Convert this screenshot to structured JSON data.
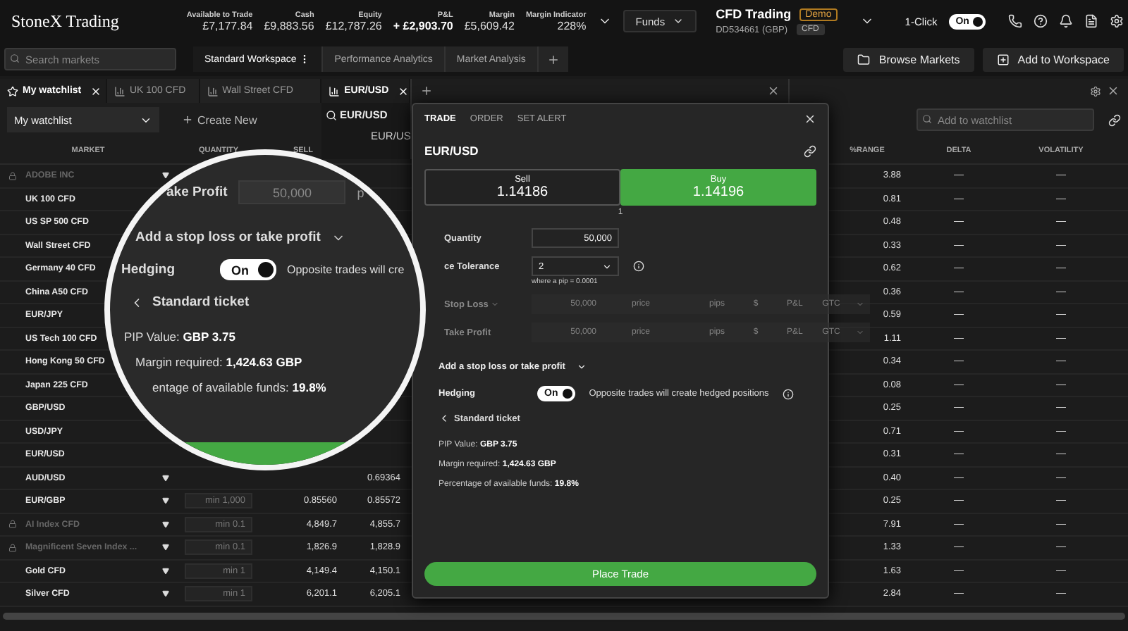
{
  "top_bar": {
    "logo": "StoneX Trading",
    "stats": [
      {
        "label": "Available to Trade",
        "value": "£7,177.84",
        "emphasis": false
      },
      {
        "label": "Cash",
        "value": "£9,883.56",
        "emphasis": false
      },
      {
        "label": "Equity",
        "value": "£12,787.26",
        "emphasis": false
      },
      {
        "label": "P&L",
        "value": "+ £2,903.70",
        "emphasis": true
      },
      {
        "label": "Margin",
        "value": "£5,609.42",
        "emphasis": false
      },
      {
        "label": "Margin Indicator",
        "value": "228%",
        "emphasis": false
      }
    ],
    "funds_button": "Funds",
    "account": {
      "name": "CFD Trading",
      "badge": "Demo",
      "id": "DD534661 (GBP)",
      "tag": "CFD"
    },
    "one_click": {
      "label": "1-Click",
      "on": true,
      "state_label": "On"
    }
  },
  "search": {
    "placeholder": "Search markets"
  },
  "workspace_tabs": [
    {
      "label": "Standard Workspace",
      "selected": true
    },
    {
      "label": "Performance Analytics",
      "selected": false
    },
    {
      "label": "Market Analysis",
      "selected": false
    }
  ],
  "actions": [
    "Browse Markets",
    "Add to Workspace"
  ],
  "panel_tabs": [
    {
      "label": "My watchlist",
      "kind": "watchlist",
      "selected": true,
      "closable": true
    },
    {
      "label": "UK 100 CFD",
      "kind": "chart",
      "selected": false,
      "closable": false
    },
    {
      "label": "Wall Street CFD",
      "kind": "chart",
      "selected": false,
      "closable": false
    },
    {
      "label": "EUR/USD",
      "kind": "chart",
      "selected": true,
      "closable": true
    }
  ],
  "watchlist": {
    "dropdown": "My watchlist",
    "create": "Create New",
    "add_placeholder": "Add to watchlist",
    "columns": [
      "MARKET",
      "QUANTITY",
      "SELL",
      "%RANGE",
      "DELTA",
      "VOLATILITY"
    ],
    "rows": [
      {
        "name": "ADOBE INC",
        "locked": true,
        "dropdown": true,
        "range": "3.88",
        "delta": "—",
        "volatility": "—"
      },
      {
        "name": "UK 100 CFD",
        "locked": false,
        "range": "0.81",
        "delta": "—",
        "volatility": "—"
      },
      {
        "name": "US SP 500 CFD",
        "locked": false,
        "range": "0.48",
        "delta": "—",
        "volatility": "—"
      },
      {
        "name": "Wall Street CFD",
        "locked": false,
        "range": "0.33",
        "delta": "—",
        "volatility": "—"
      },
      {
        "name": "Germany 40 CFD",
        "locked": false,
        "range": "0.62",
        "delta": "—",
        "volatility": "—"
      },
      {
        "name": "China A50 CFD",
        "locked": false,
        "range": "0.36",
        "delta": "—",
        "volatility": "—"
      },
      {
        "name": "EUR/JPY",
        "locked": false,
        "range": "0.59",
        "delta": "—",
        "volatility": "—"
      },
      {
        "name": "US Tech 100 CFD",
        "locked": false,
        "range": "1.11",
        "delta": "—",
        "volatility": "—"
      },
      {
        "name": "Hong Kong 50 CFD",
        "locked": false,
        "range": "0.34",
        "delta": "—",
        "volatility": "—"
      },
      {
        "name": "Japan 225 CFD",
        "locked": false,
        "range": "0.08",
        "delta": "—",
        "volatility": "—"
      },
      {
        "name": "GBP/USD",
        "locked": false,
        "range": "0.25",
        "delta": "—",
        "volatility": "—"
      },
      {
        "name": "USD/JPY",
        "locked": false,
        "range": "0.71",
        "delta": "—",
        "volatility": "—"
      },
      {
        "name": "EUR/USD",
        "locked": false,
        "range": "0.31",
        "delta": "—",
        "volatility": "—"
      },
      {
        "name": "AUD/USD",
        "locked": false,
        "dropdown": true,
        "buy": "0.69364",
        "range": "0.40",
        "delta": "—",
        "volatility": "—"
      },
      {
        "name": "EUR/GBP",
        "locked": false,
        "dropdown": true,
        "quantity": "min 1,000",
        "sell": "0.85560",
        "buy": "0.85572",
        "range": "0.25",
        "delta": "—",
        "volatility": "—"
      },
      {
        "name": "AI Index CFD",
        "locked": true,
        "dropdown": true,
        "quantity": "min 0.1",
        "sell": "4,849.7",
        "buy": "4,855.7",
        "range": "7.91",
        "delta": "—",
        "volatility": "—"
      },
      {
        "name": "Magnificent Seven Index ...",
        "locked": true,
        "dropdown": true,
        "quantity": "min 0.1",
        "sell": "1,826.9",
        "buy": "1,828.9",
        "range": "1.33",
        "delta": "—",
        "volatility": "—"
      },
      {
        "name": "Gold CFD",
        "locked": false,
        "dropdown": true,
        "quantity": "min 1",
        "sell": "4,149.4",
        "buy": "4,150.1",
        "range": "1.63",
        "delta": "—",
        "volatility": "—"
      },
      {
        "name": "Silver CFD",
        "locked": false,
        "dropdown": true,
        "quantity": "min 1",
        "sell": "6,201.1",
        "buy": "6,205.1",
        "range": "2.84",
        "delta": "—",
        "volatility": "—"
      }
    ]
  },
  "chart": {
    "search": "EUR/USD",
    "symbol": "EUR/US"
  },
  "ticket": {
    "tabs": [
      {
        "label": "TRADE",
        "selected": true
      },
      {
        "label": "ORDER",
        "selected": false
      },
      {
        "label": "SET ALERT",
        "selected": false
      }
    ],
    "title": "EUR/USD",
    "sides": [
      {
        "label": "Sell",
        "price": "1.14186",
        "selected": false
      },
      {
        "label": "Buy",
        "price": "1.14196",
        "selected": true
      }
    ],
    "spread": "1",
    "quantity_label": "Quantity",
    "quantity": "50,000",
    "tolerance_label": "ce Tolerance",
    "tolerance": "2",
    "tolerance_hint": "where a pip = 0.0001",
    "orders": [
      {
        "label": "Stop Loss",
        "expandable": true,
        "disabled": true,
        "amount": "50,000",
        "price": "price",
        "pips": "pips",
        "currency": "$",
        "pnl": "P&L",
        "expiry": "GTC"
      },
      {
        "label": "Take Profit",
        "expandable": false,
        "disabled": true,
        "amount": "50,000",
        "price": "price",
        "pips": "pips",
        "currency": "$",
        "pnl": "P&L",
        "expiry": "GTC"
      }
    ],
    "expander": "Add a stop loss or take profit",
    "hedging_label": "Hedging",
    "hedging_on": true,
    "toggle_label": "On",
    "hedging_note": "Opposite trades will create hedged positions",
    "back_link": "Standard ticket",
    "facts": [
      "PIP Value: **GBP 3.75**",
      "Margin required: **1,424.63 GBP**",
      "Percentage of available funds: **19.8%**"
    ],
    "submit": "Place Trade"
  },
  "magnifier": {
    "take_profit_label": "ake Profit",
    "take_profit_amount": "50,000",
    "take_profit_next": "p",
    "expander": "Add a stop loss or take profit",
    "hedging_label": "Hedging",
    "hedging_on": true,
    "toggle_label": "On",
    "hedging_note": "Opposite trades will cre",
    "back_link": "Standard ticket",
    "facts": [
      "PIP Value: **GBP 3.75**",
      "Margin required: **1,424.63 GBP**",
      "entage of available funds: **19.8%**"
    ]
  }
}
